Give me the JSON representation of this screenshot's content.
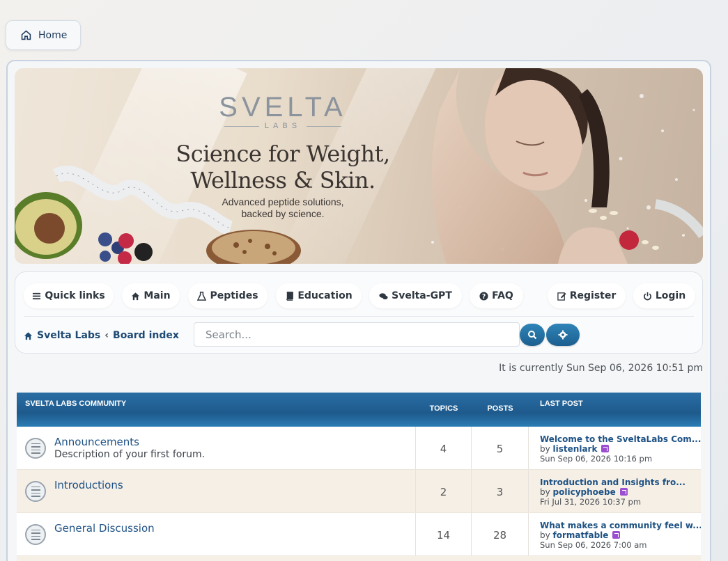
{
  "home_button": {
    "label": "Home",
    "icon": "home-icon"
  },
  "banner": {
    "brand_name": "SVELTA",
    "brand_sub": "LABS",
    "headline_1": "Science for Weight,",
    "headline_2": "Wellness & Skin.",
    "tagline_1": "Advanced peptide solutions,",
    "tagline_2": "backed by science."
  },
  "nav": {
    "items": [
      {
        "label": "Quick links",
        "icon": "bars-icon"
      },
      {
        "label": "Main",
        "icon": "home-icon"
      },
      {
        "label": "Peptides",
        "icon": "flask-icon"
      },
      {
        "label": "Education",
        "icon": "book-icon"
      },
      {
        "label": "Svelta-GPT",
        "icon": "chat-icon"
      },
      {
        "label": "FAQ",
        "icon": "question-icon"
      },
      {
        "label": "Register",
        "icon": "edit-icon"
      },
      {
        "label": "Login",
        "icon": "power-icon"
      }
    ]
  },
  "breadcrumb": {
    "home": "Svelta Labs",
    "separator": "‹",
    "current": "Board index"
  },
  "search": {
    "placeholder": "Search..."
  },
  "current_time": "It is currently Sun Sep 06, 2026 10:51 pm",
  "forum": {
    "category": "SVELTA LABS COMMUNITY",
    "col_topics": "TOPICS",
    "col_posts": "POSTS",
    "col_lastpost": "LAST POST",
    "rows": [
      {
        "title": "Announcements",
        "desc": "Description of your first forum.",
        "topics": "4",
        "posts": "5",
        "lp_title": "Welcome to the SveltaLabs Com...",
        "lp_by_prefix": "by",
        "lp_user": "listenlark",
        "lp_date": "Sun Sep 06, 2026 10:16 pm"
      },
      {
        "title": "Introductions",
        "desc": "",
        "topics": "2",
        "posts": "3",
        "lp_title": "Introduction and Insights fro...",
        "lp_by_prefix": "by",
        "lp_user": "policyphoebe",
        "lp_date": "Fri Jul 31, 2026 10:37 pm"
      },
      {
        "title": "General Discussion",
        "desc": "",
        "topics": "14",
        "posts": "28",
        "lp_title": "What makes a community feel w...",
        "lp_by_prefix": "by",
        "lp_user": "formatfable",
        "lp_date": "Sun Sep 06, 2026 7:00 am"
      }
    ]
  },
  "colors": {
    "accent": "#1e5284",
    "header_blue": "#2a6ea4",
    "button_blue": "#2f84b8",
    "goto_purple": "#9b4fd0"
  }
}
